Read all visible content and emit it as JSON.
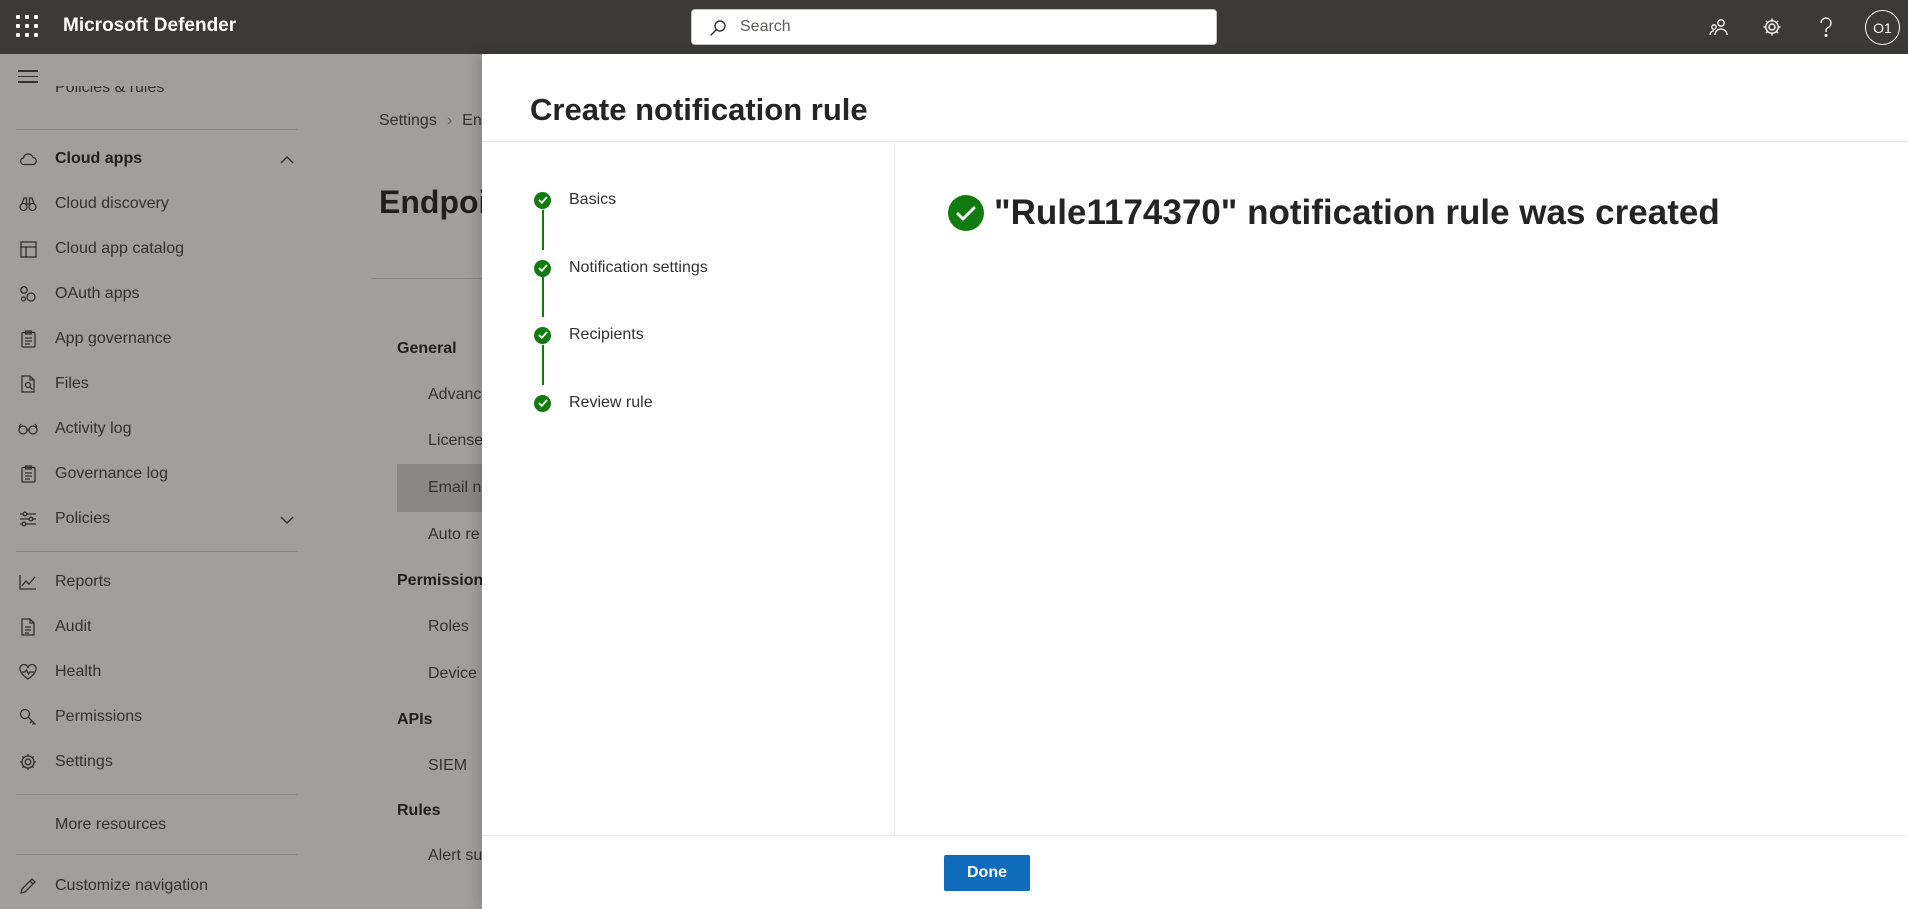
{
  "header": {
    "app_title": "Microsoft Defender",
    "search_placeholder": "Search",
    "avatar_initials": "O1"
  },
  "sidebar": {
    "cut_item": "Policies & rules",
    "items": [
      {
        "label": "Cloud apps",
        "icon": "cloud-icon"
      },
      {
        "label": "Cloud discovery",
        "icon": "binoculars-icon"
      },
      {
        "label": "Cloud app catalog",
        "icon": "catalog-icon"
      },
      {
        "label": "OAuth apps",
        "icon": "oauth-icon"
      },
      {
        "label": "App governance",
        "icon": "clipboard-icon"
      },
      {
        "label": "Files",
        "icon": "file-search-icon"
      },
      {
        "label": "Activity log",
        "icon": "glasses-icon"
      },
      {
        "label": "Governance log",
        "icon": "clipboard-icon"
      },
      {
        "label": "Policies",
        "icon": "sliders-icon"
      },
      {
        "label": "Reports",
        "icon": "chart-icon"
      },
      {
        "label": "Audit",
        "icon": "audit-icon"
      },
      {
        "label": "Health",
        "icon": "heart-pulse-icon"
      },
      {
        "label": "Permissions",
        "icon": "key-icon"
      },
      {
        "label": "Settings",
        "icon": "gear-icon"
      },
      {
        "label": "More resources",
        "icon": "more-icon"
      },
      {
        "label": "Customize navigation",
        "icon": "pencil-icon"
      }
    ]
  },
  "background_page": {
    "breadcrumb": [
      "Settings",
      "En"
    ],
    "title": "Endpoi",
    "sections": [
      {
        "header": "General",
        "items": [
          "Advanc",
          "Licenses",
          "Email n",
          "Auto re"
        ]
      },
      {
        "header": "Permissions",
        "items": [
          "Roles",
          "Device g"
        ]
      },
      {
        "header": "APIs",
        "items": [
          "SIEM"
        ]
      },
      {
        "header": "Rules",
        "items": [
          "Alert su"
        ]
      }
    ]
  },
  "panel": {
    "title": "Create notification rule",
    "steps": [
      "Basics",
      "Notification settings",
      "Recipients",
      "Review rule"
    ],
    "success_message": "\"Rule1174370\" notification rule was created",
    "done_label": "Done"
  },
  "colors": {
    "topbar": "#3b3a39",
    "success_green": "#107c10",
    "primary_blue": "#0f6cbd"
  }
}
